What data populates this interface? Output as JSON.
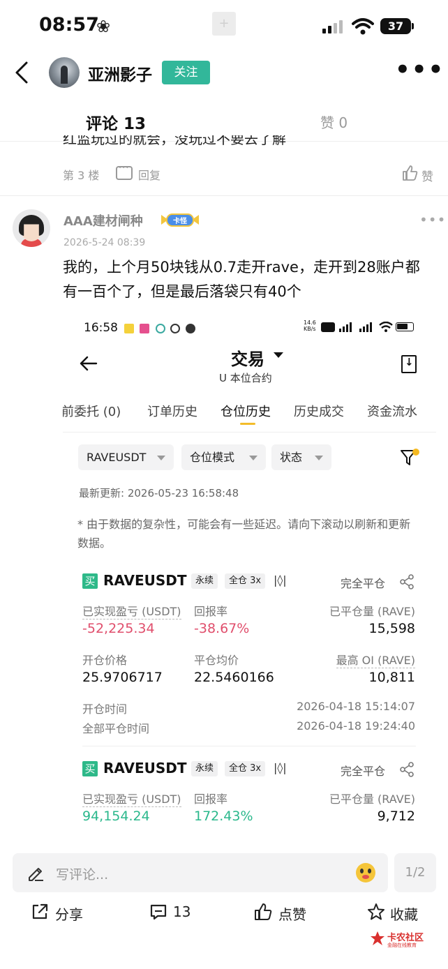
{
  "status_bar": {
    "time": "08:57",
    "battery": "37"
  },
  "header": {
    "username": "亚洲影子",
    "follow_label": "关注"
  },
  "tabs": {
    "comments": "评论 13",
    "likes": "赞 0"
  },
  "prev_comment": {
    "text_cut": "红监玩过的就会，没玩过不要去了解",
    "floor": "第 3 楼",
    "reply": "回复",
    "like": "赞"
  },
  "comment": {
    "name": "AAA建材闸种",
    "badge": "卡怪",
    "date": "2026-5-24 08:39",
    "text": "我的，上个月50块钱从0.7走开rave，走开到28账户都有一百个了，但是最后落袋只有40个"
  },
  "screenshot": {
    "time": "16:58",
    "net_speed": "14.6 KB/s",
    "title": "交易",
    "subtitle": "U 本位合约",
    "tabs": [
      "前委托 (0)",
      "订单历史",
      "仓位历史",
      "历史成交",
      "资金流水"
    ],
    "active_tab": "仓位历史",
    "filters": [
      "RAVEUSDT",
      "仓位模式",
      "状态"
    ],
    "last_update": "最新更新: 2026-05-23 16:58:48",
    "note": "* 由于数据的复杂性，可能会有一些延迟。请向下滚动以刷新和更新数据。",
    "positions": [
      {
        "side": "买",
        "symbol": "RAVEUSDT",
        "type": "永续",
        "margin": "全仓 3x",
        "status": "完全平仓",
        "pnl_label": "已实现盈亏 (USDT)",
        "pnl": "-52,225.34",
        "roi_label": "回报率",
        "roi": "-38.67%",
        "closed_label": "已平仓量 (RAVE)",
        "closed": "15,598",
        "open_price_label": "开仓价格",
        "open_price": "25.9706717",
        "avg_close_label": "平仓均价",
        "avg_close": "22.5460166",
        "max_oi_label": "最高 OI (RAVE)",
        "max_oi": "10,811",
        "open_time_label": "开仓时间",
        "open_time": "2026-04-18 15:14:07",
        "close_time_label": "全部平仓时间",
        "close_time": "2026-04-18 19:24:40"
      },
      {
        "side": "买",
        "symbol": "RAVEUSDT",
        "type": "永续",
        "margin": "全仓 3x",
        "status": "完全平仓",
        "pnl_label": "已实现盈亏 (USDT)",
        "pnl": "94,154.24",
        "roi_label": "回报率",
        "roi": "172.43%",
        "closed_label": "已平仓量 (RAVE)",
        "closed": "9,712"
      }
    ]
  },
  "bottom": {
    "placeholder": "写评论...",
    "page": "1/2",
    "share": "分享",
    "comments": "13",
    "like": "点赞",
    "favorite": "收藏",
    "watermark": "卡农社区",
    "watermark_sub": "金融在线教育"
  },
  "colors": {
    "accent": "#32b79a",
    "loss": "#e04e6c",
    "gain": "#2bb88c",
    "tab_underline": "#f3bc2a"
  }
}
